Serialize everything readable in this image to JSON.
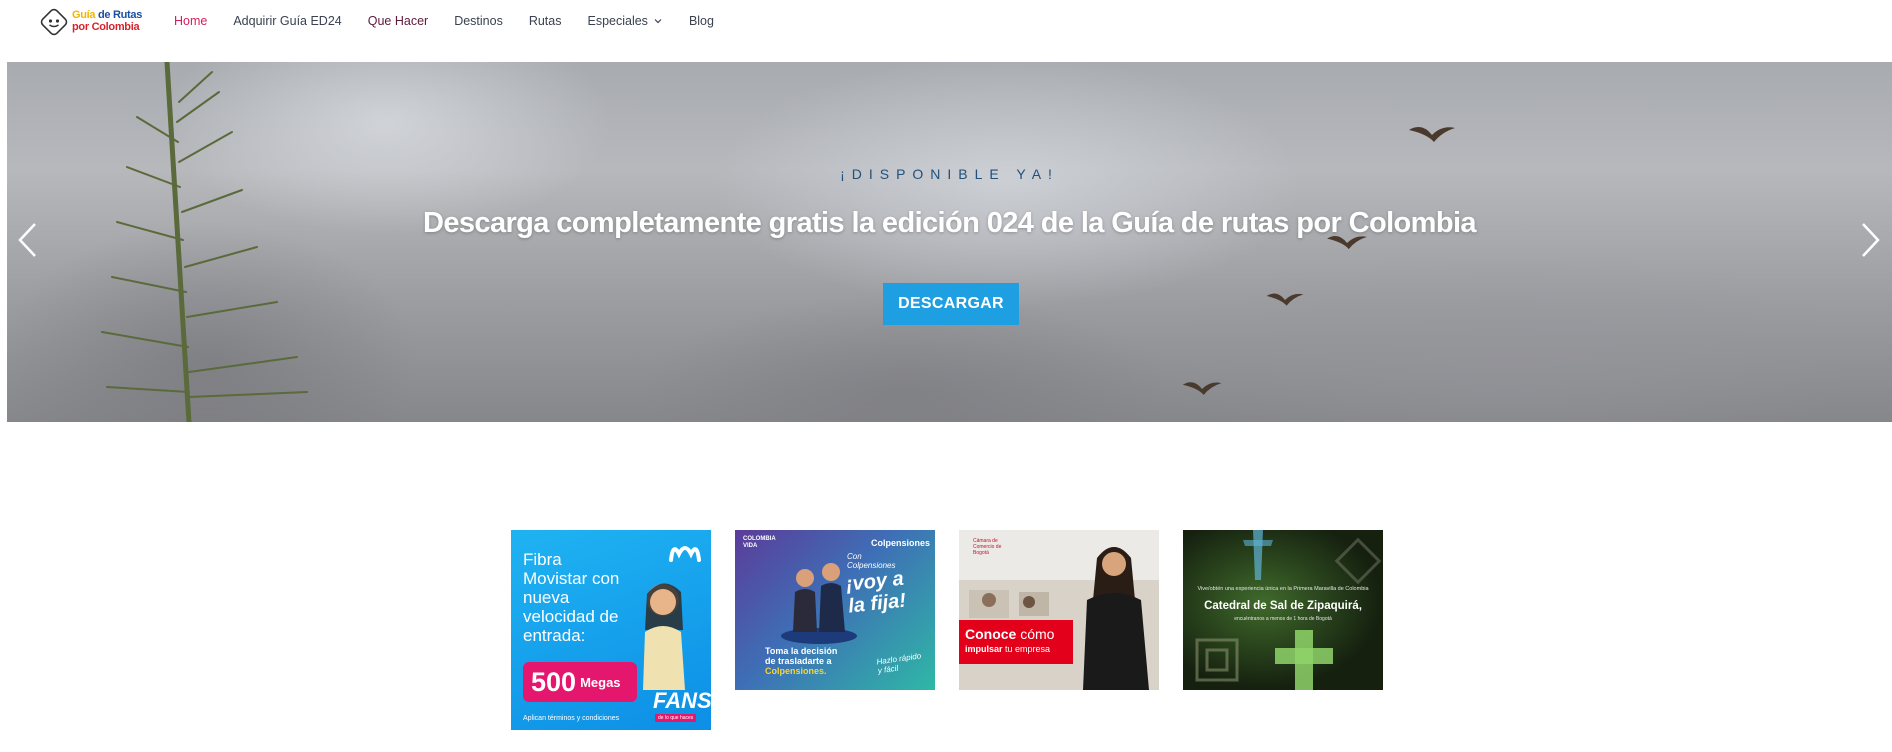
{
  "header": {
    "logo": {
      "line1_a": "Guía",
      "line1_b": " de Rutas",
      "line2": "por Colombia"
    },
    "nav": [
      {
        "label": "Home",
        "active": true
      },
      {
        "label": "Adquirir Guía ED24"
      },
      {
        "label": "Que Hacer"
      },
      {
        "label": "Destinos"
      },
      {
        "label": "Rutas"
      },
      {
        "label": "Especiales",
        "has_dropdown": true
      },
      {
        "label": "Blog"
      }
    ]
  },
  "hero": {
    "kicker": "¡DISPONIBLE YA!",
    "title": "Descarga completamente gratis la edición 024 de la Guía de rutas por Colombia",
    "button": "DESCARGAR",
    "button_color": "#1e9fe2",
    "prev_icon": "chevron-left-icon",
    "next_icon": "chevron-right-icon"
  },
  "ads": [
    {
      "text": "Fibra Movistar con nueva velocidad de entrada:",
      "speed_number": "500",
      "speed_unit": "Megas",
      "terms": "Aplican términos y condiciones",
      "fans": "FANS",
      "fans_sub": "de lo que haces"
    },
    {
      "brand_left": "COLOMBIA VIDA",
      "brand_right": "Colpensiones",
      "con": "Con Colpensiones",
      "headline": "¡voy a la fija!",
      "body_l1": "Toma la decisión",
      "body_l2": "de trasladarte a",
      "body_l3": "Colpensiones.",
      "tagline": "Hazlo rápido y fácil"
    },
    {
      "org": "Cámara de Comercio de Bogotá",
      "conoce_bold": "Conoce",
      "conoce_rest": " cómo",
      "impulsar_bold": "impulsar",
      "impulsar_rest": " tu empresa"
    },
    {
      "vive": "Vive/obtén una experiencia única en la Primera Maravilla de Colombia",
      "title": "Catedral de Sal de Zipaquirá,",
      "subtitle": "encuéntranos a menos de 1 hora de Bogotá"
    }
  ]
}
